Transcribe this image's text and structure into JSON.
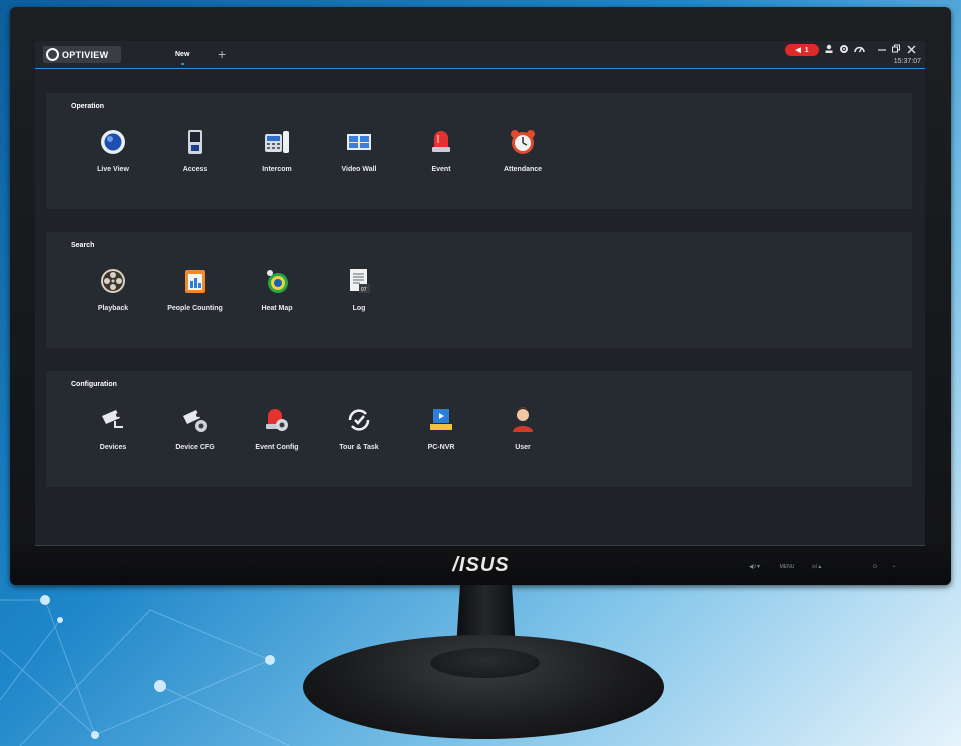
{
  "app": {
    "logo_text": "OPTIVIEW",
    "tabs": [
      {
        "label": "New"
      }
    ],
    "add_tab_icon": "plus-icon",
    "alarm_count": "1",
    "clock": "15:37:07",
    "accent": "#2f8fd0",
    "alarm_color": "#e02a2a"
  },
  "monitor": {
    "brand": "/ISUS",
    "buttons": [
      "",
      "◀)/▼",
      "MENU",
      "⊙/▲",
      "",
      "⏻",
      "•"
    ]
  },
  "sections": [
    {
      "title": "Operation",
      "items": [
        {
          "label": "Live View",
          "icon": "live-view-icon"
        },
        {
          "label": "Access",
          "icon": "access-icon"
        },
        {
          "label": "Intercom",
          "icon": "intercom-icon"
        },
        {
          "label": "Video Wall",
          "icon": "video-wall-icon"
        },
        {
          "label": "Event",
          "icon": "event-icon"
        },
        {
          "label": "Attendance",
          "icon": "attendance-icon"
        }
      ]
    },
    {
      "title": "Search",
      "items": [
        {
          "label": "Playback",
          "icon": "playback-icon"
        },
        {
          "label": "People Counting",
          "icon": "people-counting-icon"
        },
        {
          "label": "Heat Map",
          "icon": "heat-map-icon"
        },
        {
          "label": "Log",
          "icon": "log-icon"
        }
      ]
    },
    {
      "title": "Configuration",
      "items": [
        {
          "label": "Devices",
          "icon": "devices-icon"
        },
        {
          "label": "Device CFG",
          "icon": "device-cfg-icon"
        },
        {
          "label": "Event Config",
          "icon": "event-config-icon"
        },
        {
          "label": "Tour & Task",
          "icon": "tour-task-icon"
        },
        {
          "label": "PC-NVR",
          "icon": "pc-nvr-icon"
        },
        {
          "label": "User",
          "icon": "user-icon"
        }
      ]
    }
  ]
}
